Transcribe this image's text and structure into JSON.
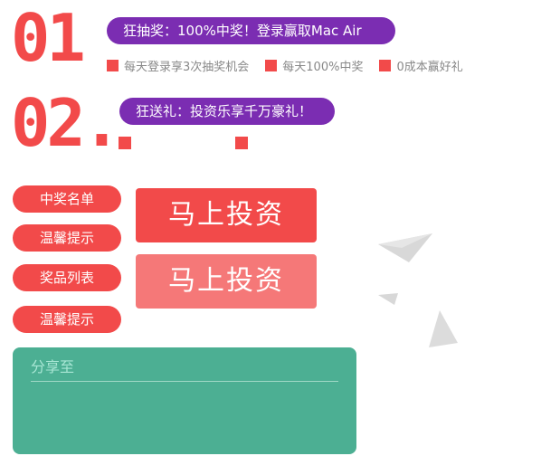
{
  "sections": {
    "first": {
      "number": "01",
      "headline": "狂抽奖：100%中奖！登录赢取Mac Air",
      "features": [
        "每天登录享3次抽奖机会",
        "每天100%中奖",
        "0成本赢好礼"
      ]
    },
    "second": {
      "number": "02.",
      "headline": "狂送礼：投资乐享千万豪礼！"
    }
  },
  "side_menu": [
    "中奖名单",
    "温馨提示",
    "奖品列表",
    "温馨提示"
  ],
  "invest_buttons": [
    "马上投资",
    "马上投资"
  ],
  "share": {
    "label": "分享至"
  },
  "colors": {
    "accent_red": "#f24a4a",
    "light_red": "#f57878",
    "purple": "#7b2db2",
    "teal": "#4caf93",
    "gray_text": "#888888"
  }
}
